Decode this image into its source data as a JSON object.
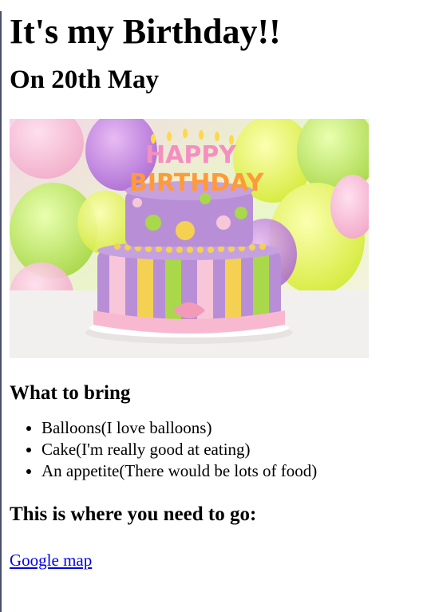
{
  "heading": "It's my Birthday!!",
  "subheading": "On 20th May",
  "image": {
    "description_icon": "birthday-cake-image",
    "cake_sign_word1": "HAPPY",
    "cake_sign_word2": "BIRTHDAY"
  },
  "bring": {
    "title": "What to bring",
    "items": [
      "Balloons(I love balloons)",
      "Cake(I'm really good at eating)",
      "An appetite(There would be lots of food)"
    ]
  },
  "directions": {
    "title": "This is where you need to go:",
    "link_label": "Google map"
  },
  "colors": {
    "link": "#0000ee",
    "text": "#000000"
  }
}
